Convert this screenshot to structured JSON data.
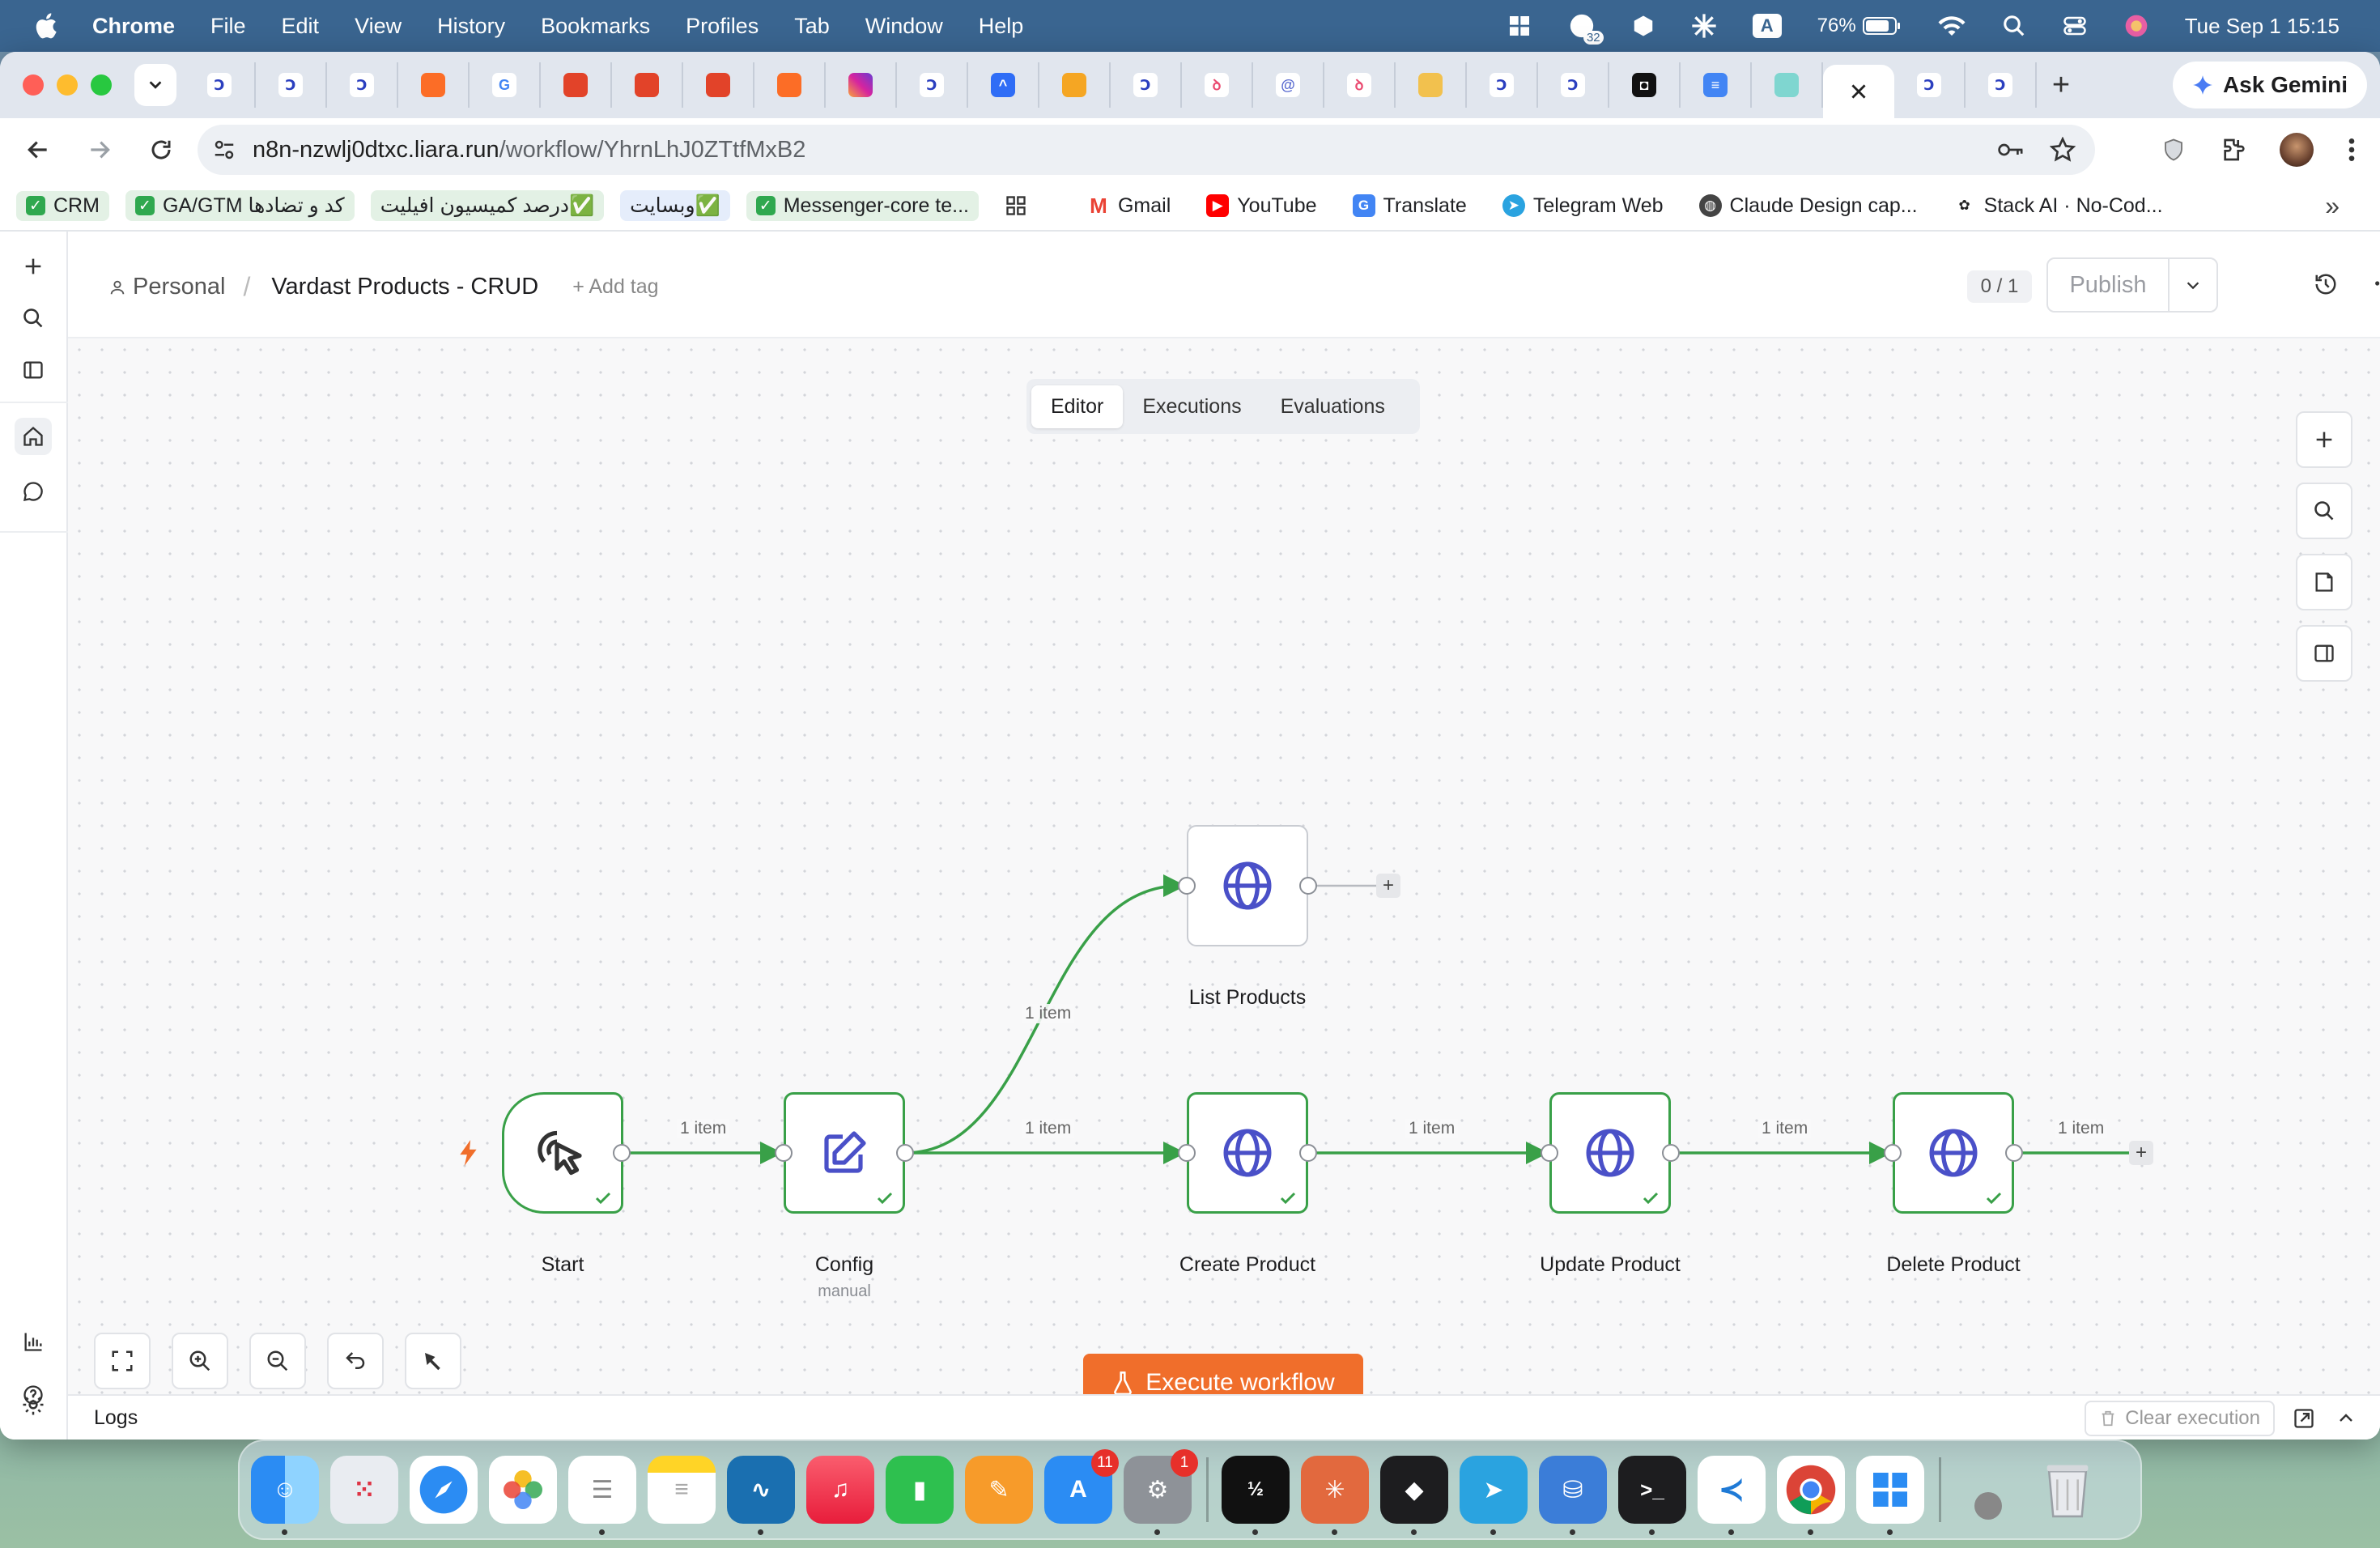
{
  "menubar": {
    "app": "Chrome",
    "items": [
      "File",
      "Edit",
      "View",
      "History",
      "Bookmarks",
      "Profiles",
      "Tab",
      "Window",
      "Help"
    ],
    "battery": "76%",
    "notif_count": "32",
    "input_lang": "A",
    "datetime": "Tue Sep 1  15:15"
  },
  "browser": {
    "ask_gemini": "Ask Gemini",
    "url_host": "n8n-nzwlj0dtxc.liara.run",
    "url_path": "/workflow/YhrnLhJ0ZTtfMxB2",
    "bookmarks": [
      {
        "label": "CRM",
        "style": "green"
      },
      {
        "label": "GA/GTM کد و تضادها",
        "style": "green"
      },
      {
        "label": "درصد کمیسیون افیلیت✅",
        "style": "green"
      },
      {
        "label": "وبسایت✅",
        "style": "blue"
      },
      {
        "label": "Messenger-core te...",
        "style": "green"
      }
    ],
    "bookmarks2": [
      "Gmail",
      "YouTube",
      "Translate",
      "Telegram Web",
      "Claude Design cap...",
      "Stack AI · No-Cod..."
    ]
  },
  "header": {
    "project": "Personal",
    "workflow_name": "Vardast Products - CRUD",
    "add_tag": "+ Add tag",
    "counter": "0 / 1",
    "publish": "Publish"
  },
  "tabs": [
    "Editor",
    "Executions",
    "Evaluations"
  ],
  "nodes": {
    "start": {
      "label": "Start"
    },
    "config": {
      "label": "Config",
      "sub": "manual"
    },
    "list": {
      "label": "List Products"
    },
    "create": {
      "label": "Create Product"
    },
    "update": {
      "label": "Update Product"
    },
    "delete": {
      "label": "Delete Product"
    }
  },
  "edge_label": "1 item",
  "execute_button": "Execute workflow",
  "logs": {
    "title": "Logs",
    "clear": "Clear execution"
  },
  "dock_badges": {
    "appstore": "11",
    "settings": "1"
  },
  "colors": {
    "success": "#39a048",
    "accent": "#f06e2b",
    "icon_blue": "#4a50c8"
  }
}
